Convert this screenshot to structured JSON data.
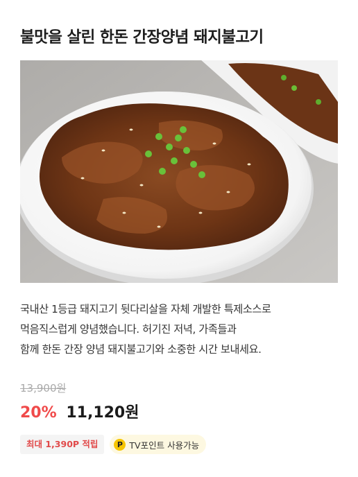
{
  "product": {
    "title": "불맛을 살린 한돈 간장양념 돼지불고기",
    "image_alt": "간장양념 돼지불고기",
    "description_lines": [
      "국내산 1등급 돼지고기 뒷다리살을 자체 개발한 특제소스로",
      "먹음직스럽게 양념했습니다. 허기진 저녁, 가족들과",
      "함께 한돈 간장 양념 돼지불고기와 소중한 시간 보내세요."
    ],
    "original_price": "13,900원",
    "discount_rate": "20%",
    "sale_price": "11,120원",
    "point_badge": "최대 1,390P 적립",
    "tv_point_icon": "P",
    "tv_point_badge": "TV포인트 사용가능"
  },
  "colors": {
    "discount": "#f04a4a",
    "point_badge_text": "#e14a4a",
    "tv_badge_bg": "#fdf8e1",
    "tv_icon": "#f7c600"
  }
}
